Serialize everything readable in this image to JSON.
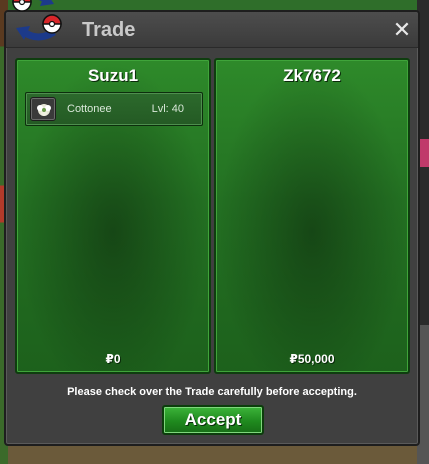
{
  "window": {
    "title": "Trade",
    "close_symbol": "✕"
  },
  "trade": {
    "left_player": {
      "name": "Suzu1",
      "money": "₽0",
      "items": [
        {
          "name": "Cottonee",
          "level": "Lvl: 40",
          "icon": "cottonee-icon"
        }
      ]
    },
    "right_player": {
      "name": "Zk7672",
      "money": "₽50,000",
      "items": []
    }
  },
  "footer": {
    "notice": "Please check over the Trade carefully before accepting.",
    "accept_label": "Accept"
  },
  "colors": {
    "panel_green": "#237022",
    "button_green": "#1f8a1e",
    "dialog_bg": "#404040",
    "title_text": "#c9c9c9"
  }
}
